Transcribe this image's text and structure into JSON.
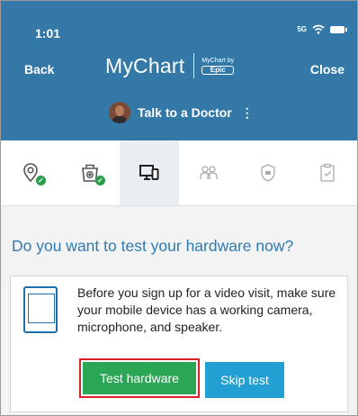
{
  "status_bar": {
    "time": "1:01",
    "signal": "5G",
    "wifi_icon": "wifi-icon",
    "battery_icon": "battery-icon"
  },
  "header": {
    "back_label": "Back",
    "close_label": "Close",
    "logo_text": "MyChart",
    "logo_by": "MyChart by",
    "logo_brand": "Epic",
    "talk_label": "Talk to a Doctor",
    "menu_glyph": "⋮",
    "background": "#3478a8"
  },
  "steps": [
    {
      "icon": "location-pin-icon",
      "completed": true
    },
    {
      "icon": "medicine-bag-icon",
      "completed": true
    },
    {
      "icon": "devices-icon",
      "completed": false,
      "active": true
    },
    {
      "icon": "people-icon",
      "completed": false
    },
    {
      "icon": "shield-card-icon",
      "completed": false
    },
    {
      "icon": "clipboard-check-icon",
      "completed": false
    }
  ],
  "main": {
    "question": "Do you want to test your hardware now?",
    "card_text": "Before you sign up for a video visit, make sure your mobile device has a working camera, microphone, and speaker.",
    "test_button": "Test hardware",
    "skip_button": "Skip test"
  },
  "colors": {
    "accent": "#2e7bb3",
    "test_green": "#2ba655",
    "skip_blue": "#22a0d4",
    "highlight_red": "#d92027",
    "check_green": "#2a9d4b"
  }
}
